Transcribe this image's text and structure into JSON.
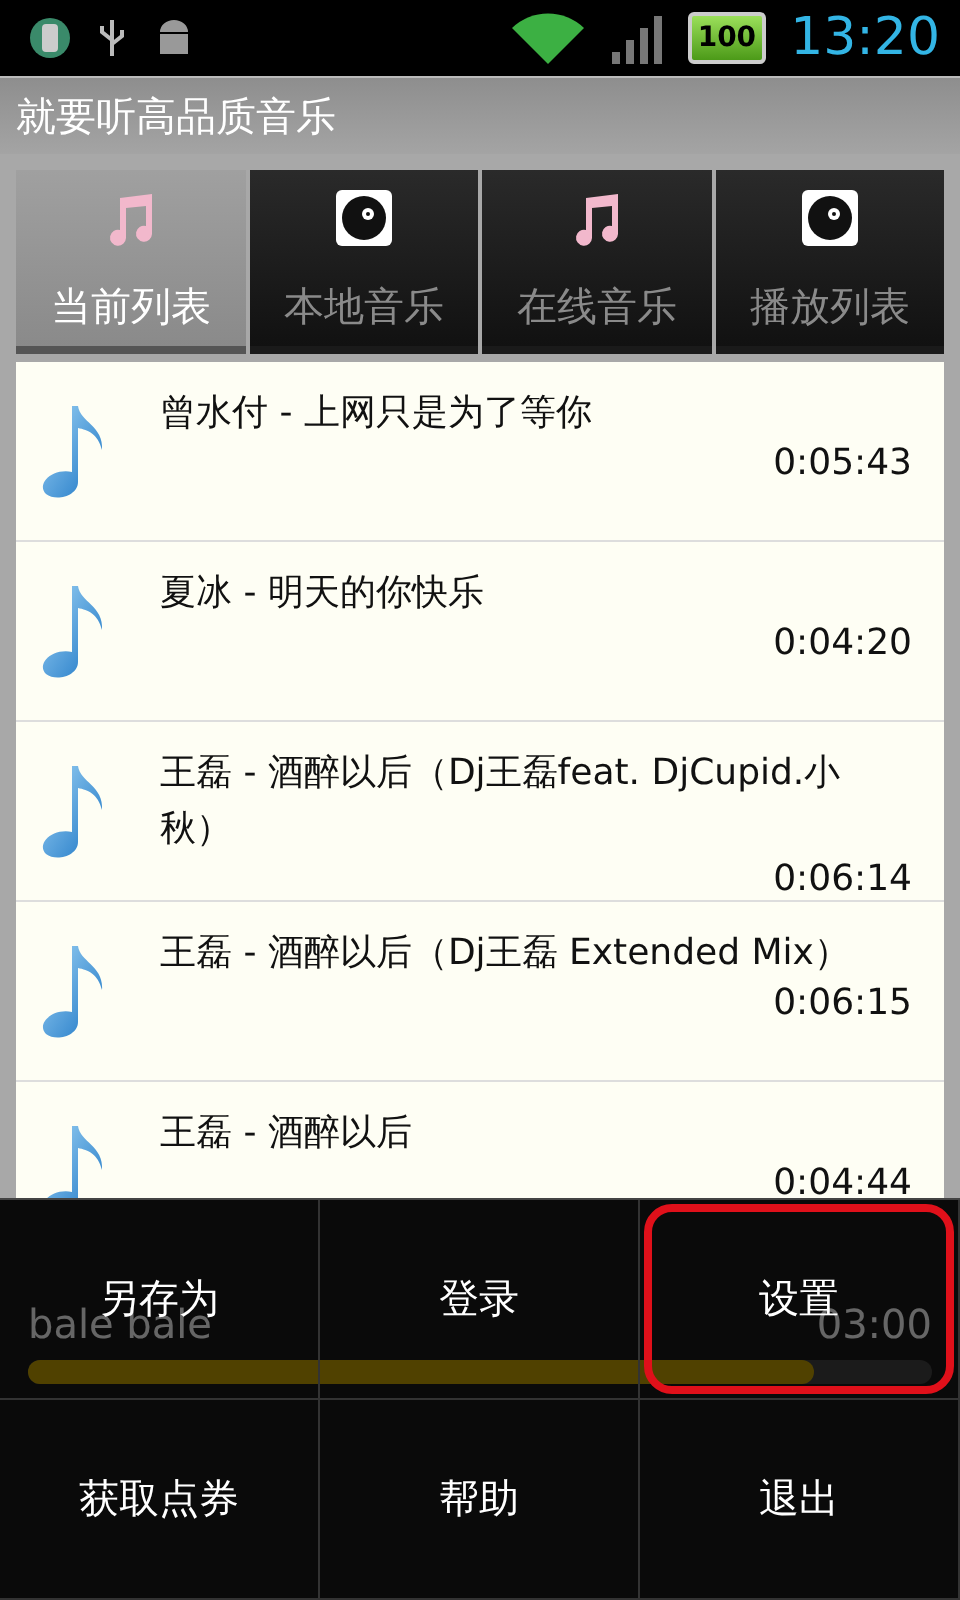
{
  "status_bar": {
    "battery": "100",
    "time": "13:20"
  },
  "window": {
    "title": "就要听高品质音乐"
  },
  "tabs": [
    {
      "label": "当前列表",
      "kind": "note",
      "selected": true
    },
    {
      "label": "本地音乐",
      "kind": "disc",
      "selected": false
    },
    {
      "label": "在线音乐",
      "kind": "note",
      "selected": false
    },
    {
      "label": "播放列表",
      "kind": "disc",
      "selected": false
    }
  ],
  "songs": [
    {
      "title": "曾水付 - 上网只是为了等你",
      "duration": "0:05:43"
    },
    {
      "title": "夏冰 - 明天的你快乐",
      "duration": "0:04:20"
    },
    {
      "title": "王磊 - 酒醉以后（Dj王磊feat. DjCupid.小秋）",
      "duration": "0:06:14"
    },
    {
      "title": "王磊 - 酒醉以后（Dj王磊 Extended Mix）",
      "duration": "0:06:15"
    },
    {
      "title": "王磊 - 酒醉以后",
      "duration": "0:04:44"
    }
  ],
  "player": {
    "title": "bale bale",
    "time": "03:00",
    "level": 0.87
  },
  "menu": [
    {
      "label": "另存为",
      "highlighted": false
    },
    {
      "label": "登录",
      "highlighted": false
    },
    {
      "label": "设置",
      "highlighted": true
    },
    {
      "label": "获取点券",
      "highlighted": false
    },
    {
      "label": "帮助",
      "highlighted": false
    },
    {
      "label": "退出",
      "highlighted": false
    }
  ]
}
